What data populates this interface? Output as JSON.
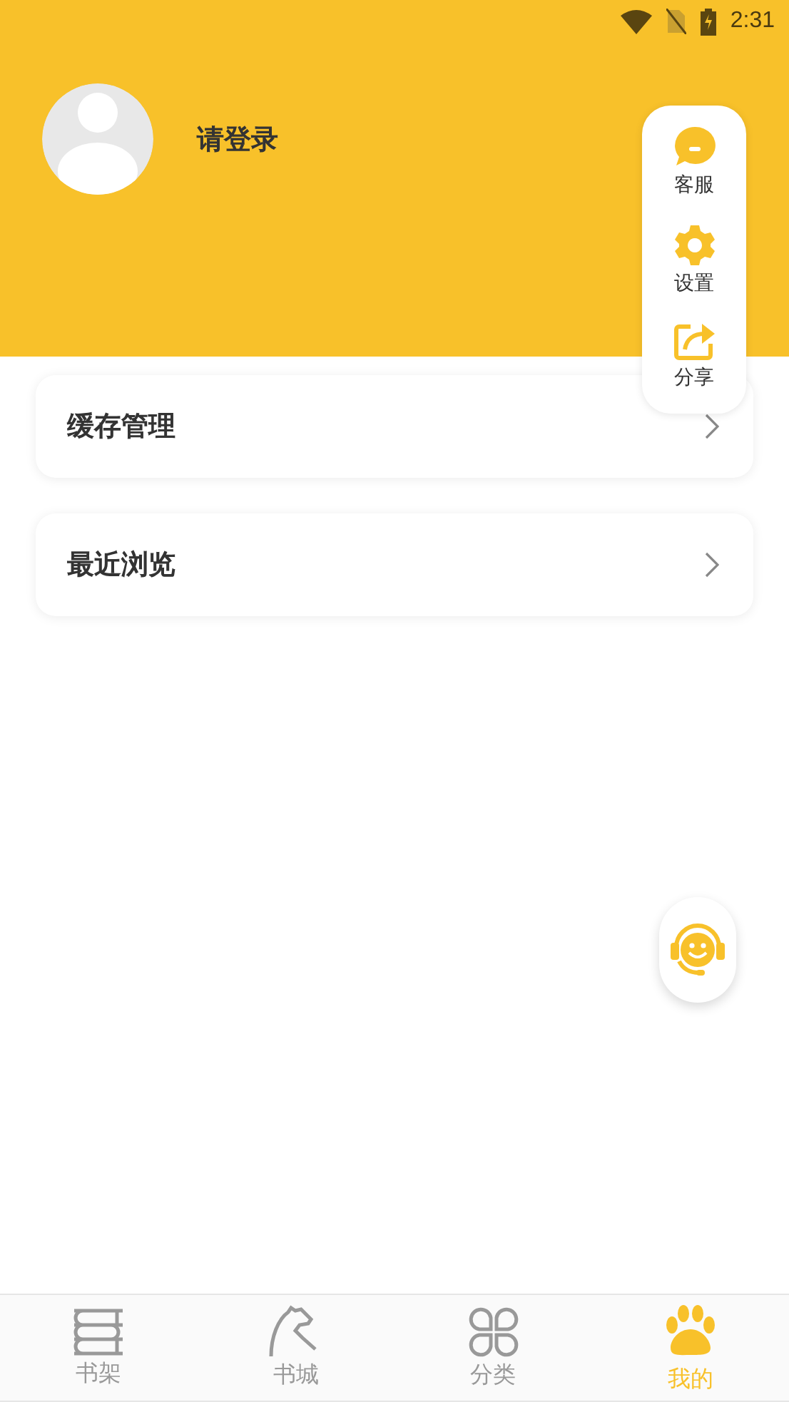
{
  "status_bar": {
    "time": "2:31"
  },
  "profile": {
    "login_prompt": "请登录"
  },
  "quick_menu": [
    {
      "label": "客服"
    },
    {
      "label": "设置"
    },
    {
      "label": "分享"
    }
  ],
  "menu": [
    {
      "label": "缓存管理"
    },
    {
      "label": "最近浏览"
    }
  ],
  "tabs": [
    {
      "label": "书架",
      "selected": false
    },
    {
      "label": "书城",
      "selected": false
    },
    {
      "label": "分类",
      "selected": false
    },
    {
      "label": "我的",
      "selected": true
    }
  ]
}
